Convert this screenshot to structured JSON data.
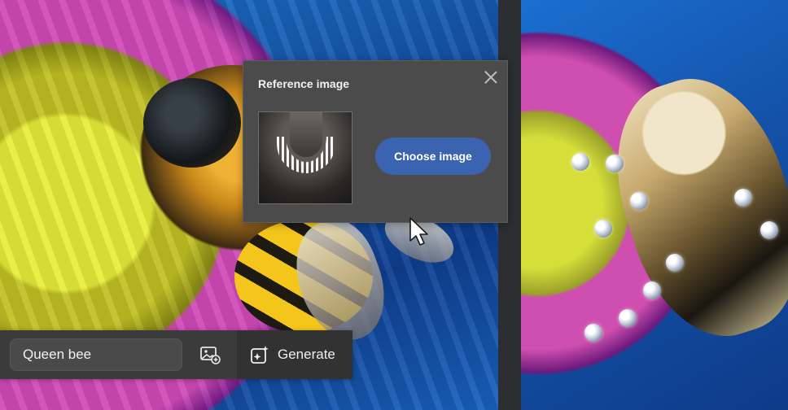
{
  "reference_panel": {
    "title": "Reference image",
    "choose_button_label": "Choose image"
  },
  "prompt_bar": {
    "input_value": "Queen bee",
    "generate_label": "Generate"
  },
  "icons": {
    "close": "close-icon",
    "reference_image": "add-image-icon",
    "generate": "sparkle-generate-icon",
    "cursor": "mouse-pointer-icon"
  },
  "colors": {
    "panel_bg": "#4b4b4b",
    "button_blue": "#3a64b0",
    "bar_bg": "#3b3b3c"
  }
}
